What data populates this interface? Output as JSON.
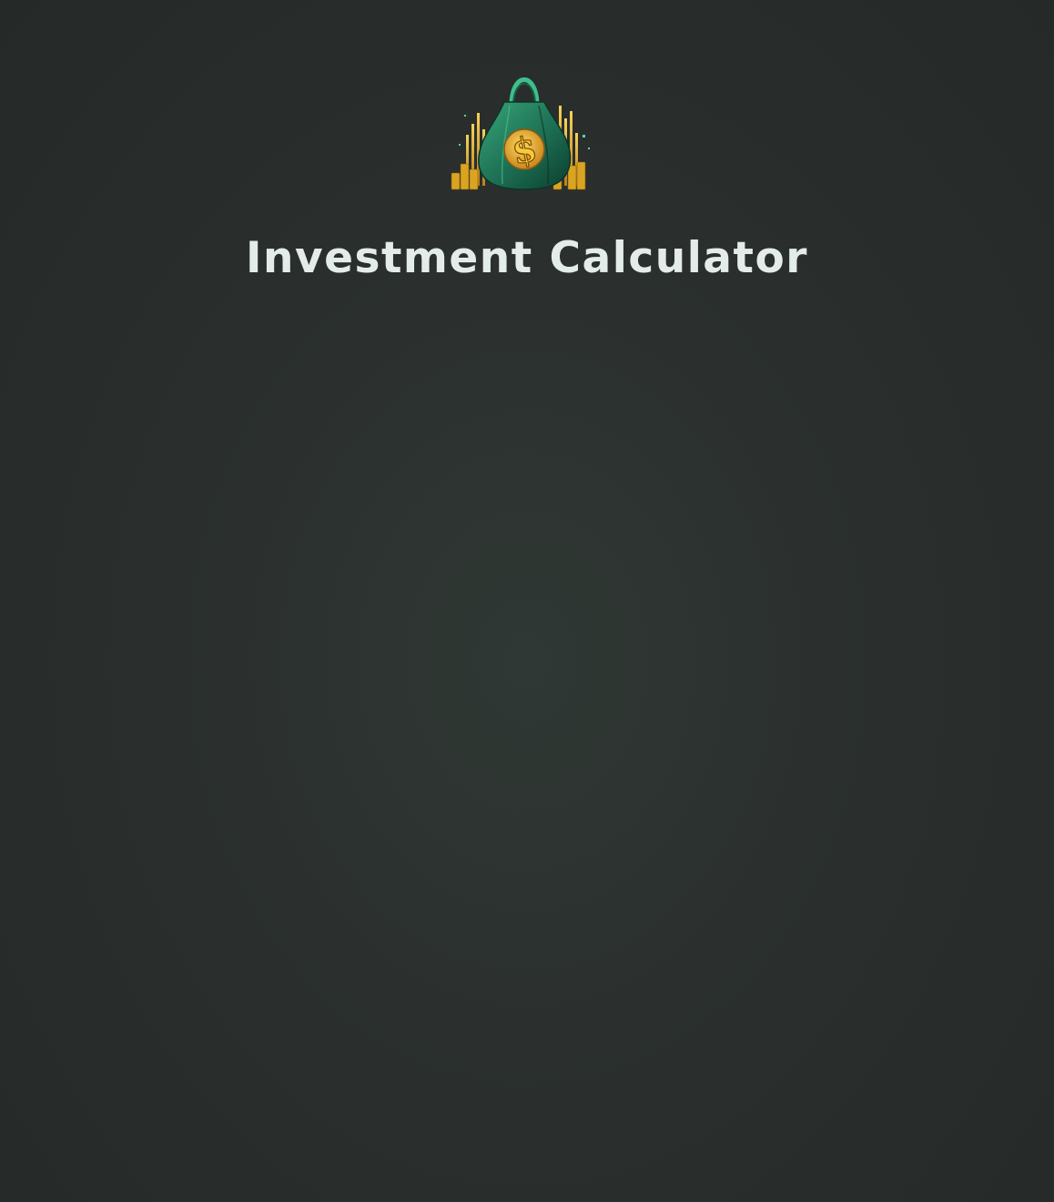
{
  "header": {
    "title": "Investment Calculator",
    "logo_icon": "money-bag-icon"
  },
  "colors": {
    "background": "#2b302e",
    "title_text": "#e3ece8",
    "bag_green": "#1f7a5a",
    "coin_gold": "#d9a521"
  }
}
